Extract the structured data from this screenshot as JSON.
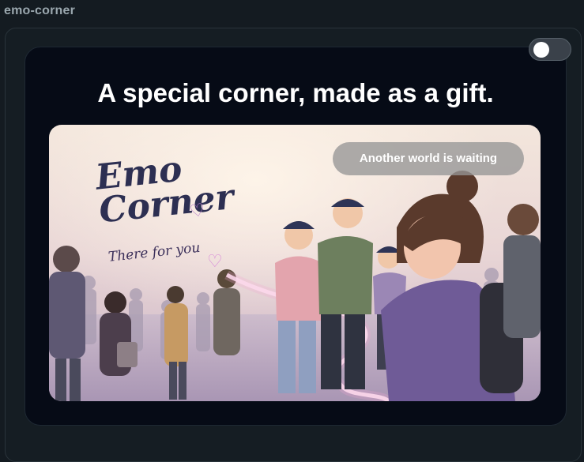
{
  "app": {
    "title": "emo-corner"
  },
  "toggle": {
    "state": "off"
  },
  "card": {
    "headline": "A special corner, made as a gift."
  },
  "hero": {
    "brand_line1": "Emo",
    "brand_line2": "Corner",
    "tagline": "There for you",
    "cta_label": "Another world is waiting",
    "cap_text": "Emo Corner"
  },
  "colors": {
    "background": "#141b21",
    "card": "#060b16",
    "cta": "#969696",
    "hoodie_purple": "#6f5b97"
  }
}
